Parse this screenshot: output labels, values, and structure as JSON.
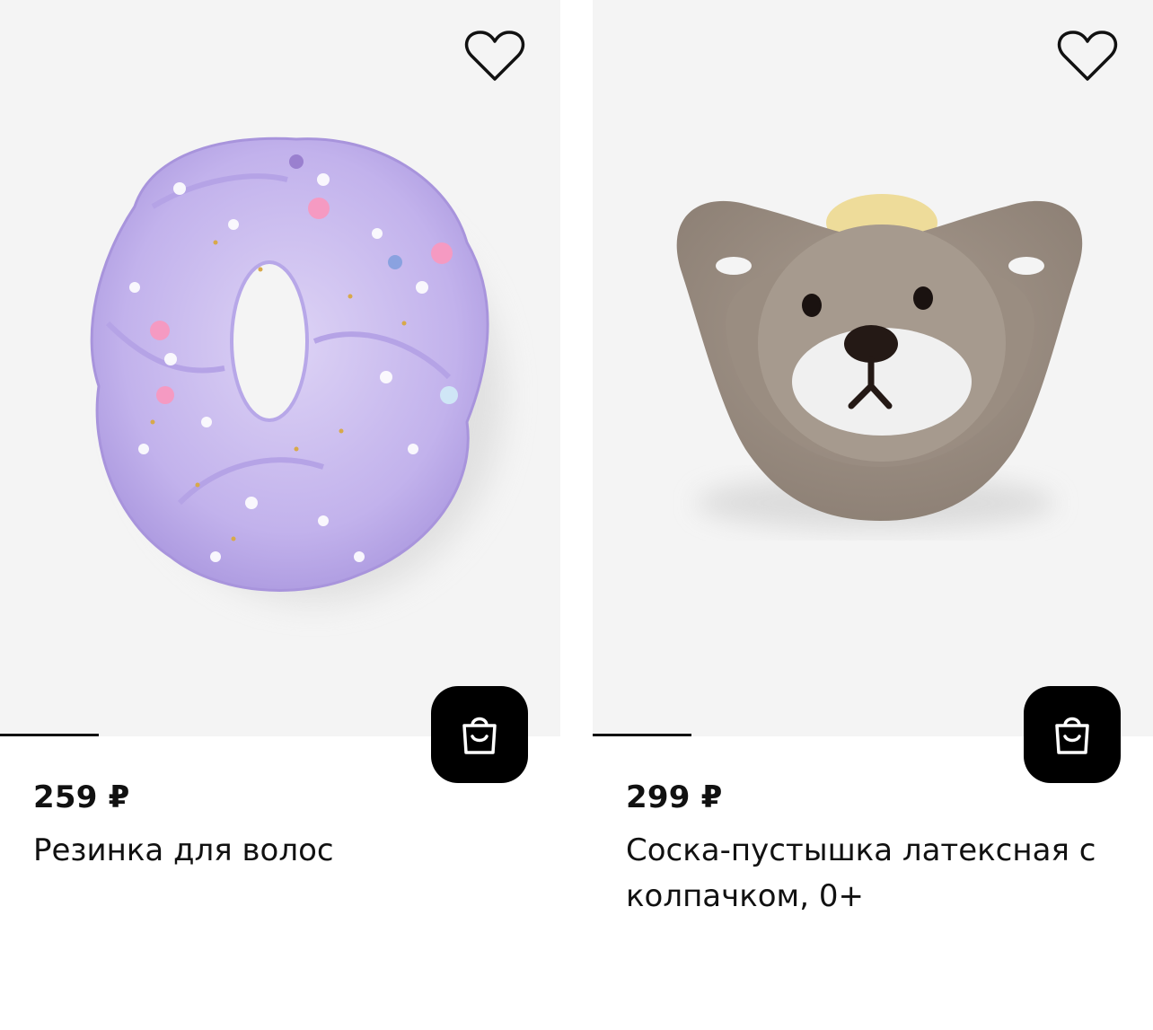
{
  "products": [
    {
      "price": "259 ₽",
      "title": "Резинка для волос",
      "image_label": "lavender organza scrunchie with flowers"
    },
    {
      "price": "299 ₽",
      "title": "Соска-пустышка латексная с колпачком, 0+",
      "image_label": "brown bear pacifier"
    }
  ],
  "icons": {
    "favorite": "heart-icon",
    "cart": "shopping-bag-icon"
  },
  "colors": {
    "image_bg": "#f4f4f4",
    "cart_button_bg": "#000000",
    "text": "#111111"
  }
}
